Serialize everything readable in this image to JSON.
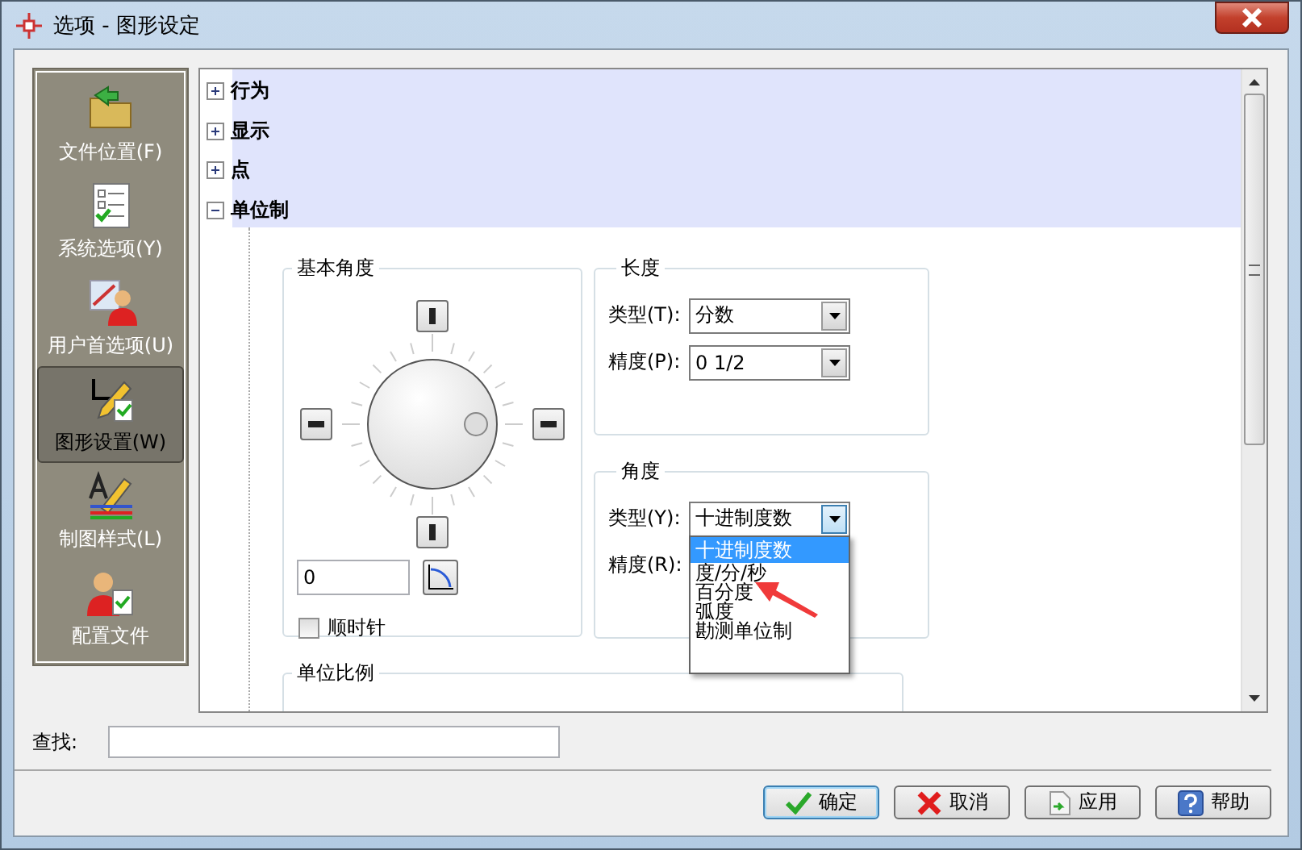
{
  "window": {
    "title": "选项 - 图形设定"
  },
  "sidebar": {
    "items": [
      {
        "label": "文件位置(F)",
        "selected": false
      },
      {
        "label": "系统选项(Y)",
        "selected": false
      },
      {
        "label": "用户首选项(U)",
        "selected": false
      },
      {
        "label": "图形设置(W)",
        "selected": true
      },
      {
        "label": "制图样式(L)",
        "selected": false
      },
      {
        "label": "配置文件",
        "selected": false
      }
    ]
  },
  "tree": {
    "items": [
      {
        "label": "行为",
        "expanded": false
      },
      {
        "label": "显示",
        "expanded": false
      },
      {
        "label": "点",
        "expanded": false
      },
      {
        "label": "单位制",
        "expanded": true
      }
    ]
  },
  "base_angle": {
    "title": "基本角度",
    "value": "0",
    "clockwise": {
      "label": "顺时针",
      "checked": false
    }
  },
  "length": {
    "title": "长度",
    "fields": [
      {
        "label": "类型(T):",
        "value": "分数",
        "open": false
      },
      {
        "label": "精度(P):",
        "value": "0 1/2",
        "open": false
      }
    ]
  },
  "angle": {
    "title": "角度",
    "fields": [
      {
        "label": "类型(Y):",
        "value": "十进制度数",
        "open": true
      },
      {
        "label": "精度(R):",
        "open": false
      }
    ],
    "options": [
      {
        "label": "十进制度数",
        "selected": true
      },
      {
        "label": "度/分/秒",
        "selected": false
      },
      {
        "label": "百分度",
        "selected": false
      },
      {
        "label": "弧度",
        "selected": false
      },
      {
        "label": "勘测单位制",
        "selected": false
      }
    ]
  },
  "unit_scale": {
    "title": "单位比例"
  },
  "find": {
    "label": "查找:"
  },
  "buttons": [
    {
      "label": "确定",
      "kind": "ok",
      "default": true
    },
    {
      "label": "取消",
      "kind": "cancel",
      "default": false
    },
    {
      "label": "应用",
      "kind": "apply",
      "default": false
    },
    {
      "label": "帮助",
      "kind": "help",
      "default": false
    }
  ]
}
